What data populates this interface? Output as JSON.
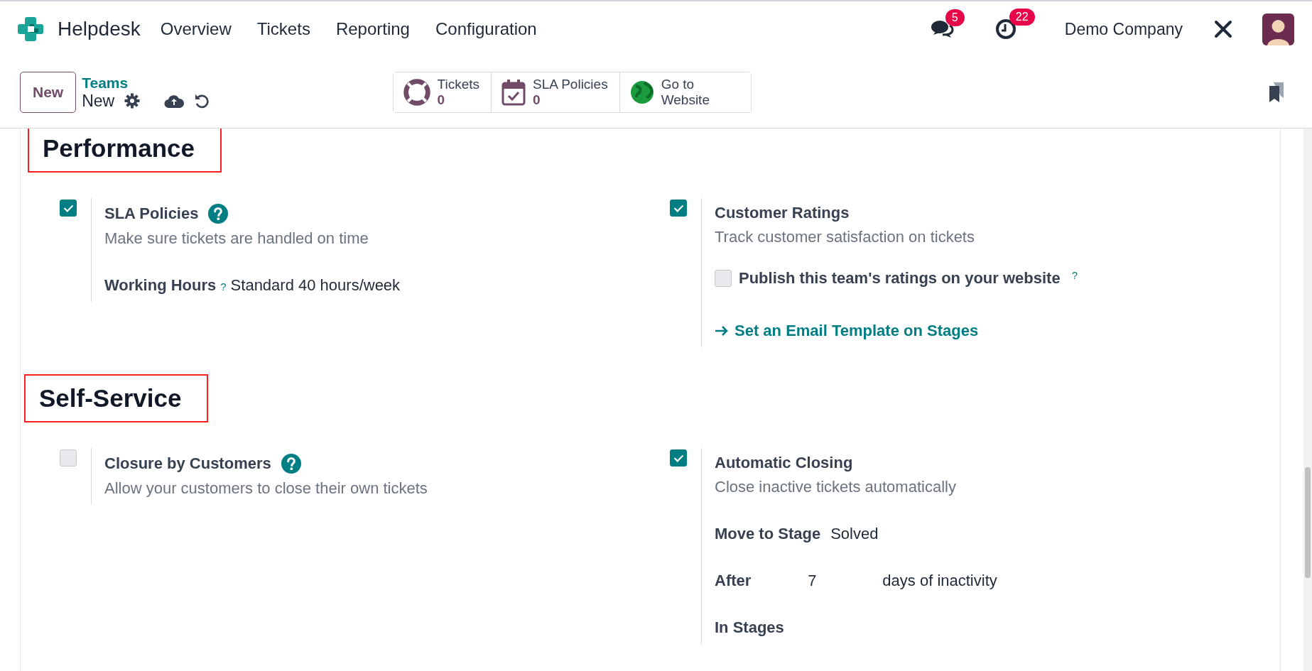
{
  "navbar": {
    "app_name": "Helpdesk",
    "menu": [
      "Overview",
      "Tickets",
      "Reporting",
      "Configuration"
    ],
    "messages_badge": "5",
    "activities_badge": "22",
    "company": "Demo Company"
  },
  "control_panel": {
    "new_button": "New",
    "breadcrumb": "Teams",
    "record_name": "New",
    "smart_buttons": [
      {
        "kind": "tickets",
        "label": "Tickets",
        "count": "0"
      },
      {
        "kind": "sla",
        "label": "SLA Policies",
        "count": "0"
      },
      {
        "kind": "website",
        "label": "Go to Website"
      }
    ]
  },
  "sections": [
    {
      "title": "Performance",
      "highlighted": true,
      "settings": [
        {
          "checked": true,
          "title": "SLA Policies",
          "help": true,
          "description": "Make sure tickets are handled on time",
          "fields": [
            {
              "label": "Working Hours",
              "help_mark": "?",
              "value": "Standard 40 hours/week"
            }
          ]
        },
        {
          "checked": true,
          "title": "Customer Ratings",
          "help": false,
          "description": "Track customer satisfaction on tickets",
          "sub_options": [
            {
              "label": "Publish this team's ratings on your website",
              "help_mark": "?",
              "checked": false
            }
          ],
          "link": "Set an Email Template on Stages"
        }
      ]
    },
    {
      "title": "Self-Service",
      "highlighted": true,
      "settings": [
        {
          "checked": false,
          "title": "Closure by Customers",
          "help": true,
          "description": "Allow your customers to close their own tickets"
        },
        {
          "checked": true,
          "title": "Automatic Closing",
          "help": false,
          "description": "Close inactive tickets automatically",
          "fields": [
            {
              "label": "Move to Stage",
              "value": "Solved"
            },
            {
              "label": "After",
              "value": "7",
              "suffix": "days of inactivity"
            },
            {
              "label": "In Stages"
            }
          ]
        }
      ]
    }
  ]
}
